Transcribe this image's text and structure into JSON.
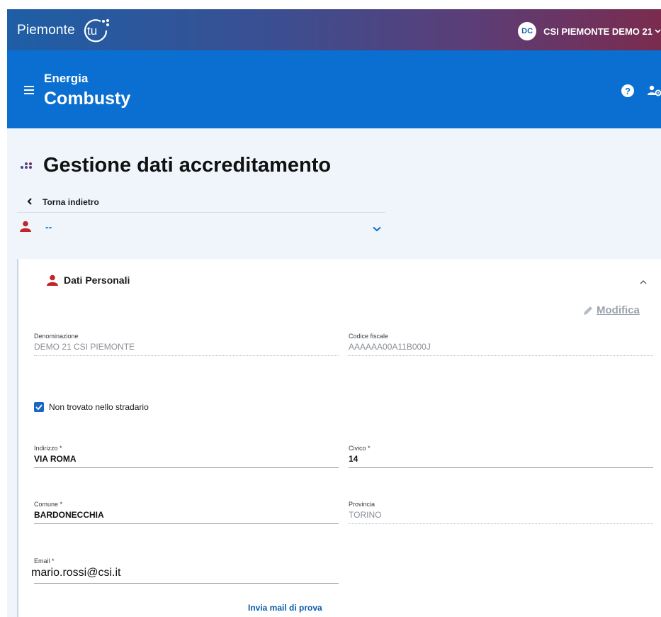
{
  "topbar": {
    "brand": "Piemonte",
    "brand_logo_text": "tu",
    "user_initials": "DC",
    "user_name": "CSI PIEMONTE DEMO 21"
  },
  "header": {
    "app_line1": "Energia",
    "app_line2": "Combusty",
    "help_glyph": "?"
  },
  "page": {
    "title": "Gestione dati accreditamento",
    "back_label": "Torna indietro",
    "selector_value": "--"
  },
  "card": {
    "section_title": "Dati Personali",
    "edit_label": "Modifica",
    "fields": {
      "denominazione": {
        "label": "Denominazione",
        "value": "DEMO 21 CSI PIEMONTE"
      },
      "codice_fiscale": {
        "label": "Codice fiscale",
        "value": "AAAAAA00A11B000J"
      },
      "indirizzo": {
        "label": "Indirizzo *",
        "value": "VIA ROMA"
      },
      "civico": {
        "label": "Civico *",
        "value": "14"
      },
      "comune": {
        "label": "Comune *",
        "value": "BARDONECCHIA"
      },
      "provincia": {
        "label": "Provincia",
        "value": "TORINO"
      },
      "email": {
        "label": "Email *",
        "value": "mario.rossi@csi.it"
      }
    },
    "checkbox": {
      "label": "Non trovato nello stradario",
      "checked": true
    },
    "test_mail_label": "Invia mail di prova"
  },
  "colors": {
    "primary_blue": "#0a6fd1",
    "accent_red": "#c0272d",
    "page_bg": "#eff5fb"
  }
}
